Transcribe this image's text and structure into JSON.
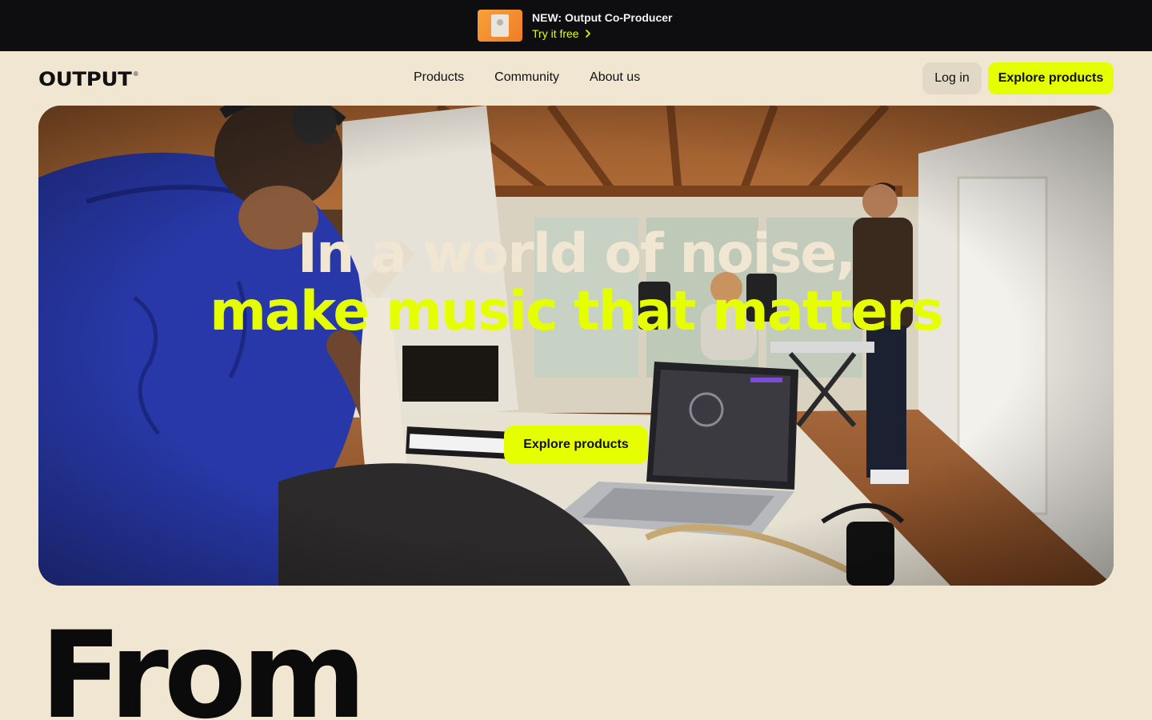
{
  "announcement": {
    "title": "NEW: Output Co-Producer",
    "cta": "Try it free",
    "cta_icon": "chevron-right-icon",
    "thumb_colors": [
      "#f7a23b",
      "#ef7c25"
    ]
  },
  "header": {
    "logo": "OUTPUT",
    "logo_mark": "®",
    "nav": [
      "Products",
      "Community",
      "About us"
    ],
    "login_label": "Log in",
    "explore_label": "Explore products"
  },
  "hero": {
    "line1": "In a world of noise,",
    "line2": "make music that matters",
    "cta": "Explore products",
    "image_description": "Musicians in a wooden-ceiling home studio with guitar, laptop and keyboard"
  },
  "section": {
    "heading": "From"
  },
  "colors": {
    "background": "#f0e6d2",
    "accent": "#e6ff00",
    "announce_bg": "#0e0e10",
    "text": "#111111"
  }
}
